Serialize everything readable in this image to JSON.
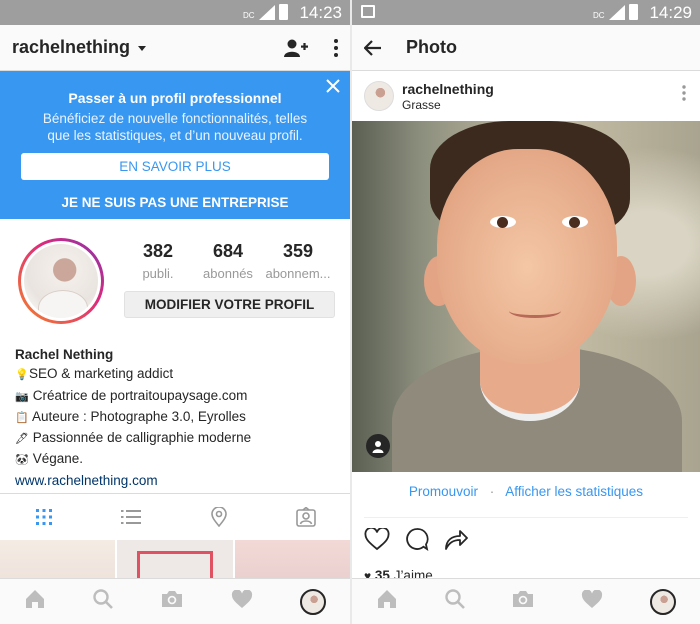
{
  "left": {
    "status_time": "14:23",
    "status_network": "DC",
    "username": "rachelnething",
    "banner": {
      "title": "Passer à un profil professionnel",
      "description": "Bénéficiez de nouvelle fonctionnalités, telles que les statistiques, et d’un nouveau profil.",
      "learn_more": "EN SAVOIR PLUS",
      "not_business": "JE NE SUIS PAS UNE ENTREPRISE"
    },
    "stats": [
      {
        "value": "382",
        "label": "publi."
      },
      {
        "value": "684",
        "label": "abonnés"
      },
      {
        "value": "359",
        "label": "abonnem..."
      }
    ],
    "edit_profile": "MODIFIER VOTRE PROFIL",
    "bio": {
      "name": "Rachel Nething",
      "lines": [
        {
          "emoji": "💡",
          "text": "SEO & marketing addict"
        },
        {
          "emoji": "📷",
          "text": "Créatrice de portraitoupaysage.com"
        },
        {
          "emoji": "📋",
          "text": "Auteure : Photographe 3.0, Eyrolles"
        },
        {
          "emoji": "🖋",
          "text": "Passionnée de calligraphie moderne"
        },
        {
          "emoji": "🐼",
          "text": "Végane."
        }
      ],
      "website": "www.rachelnething.com"
    },
    "tabs": [
      "grid-icon",
      "list-icon",
      "location-icon",
      "tagged-icon"
    ],
    "bottom_nav": [
      "home-icon",
      "search-icon",
      "camera-icon",
      "heart-icon",
      "profile-avatar"
    ]
  },
  "right": {
    "status_time": "14:29",
    "status_network": "DC",
    "title": "Photo",
    "post": {
      "username": "rachelnething",
      "location": "Grasse"
    },
    "promote": "Promouvoir",
    "separator": "·",
    "view_insights": "Afficher les statistiques",
    "likes_count": "35",
    "likes_label": "J’aime"
  },
  "colors": {
    "accent": "#3897f0",
    "link": "#003569",
    "text": "#262626",
    "muted": "#999999"
  }
}
